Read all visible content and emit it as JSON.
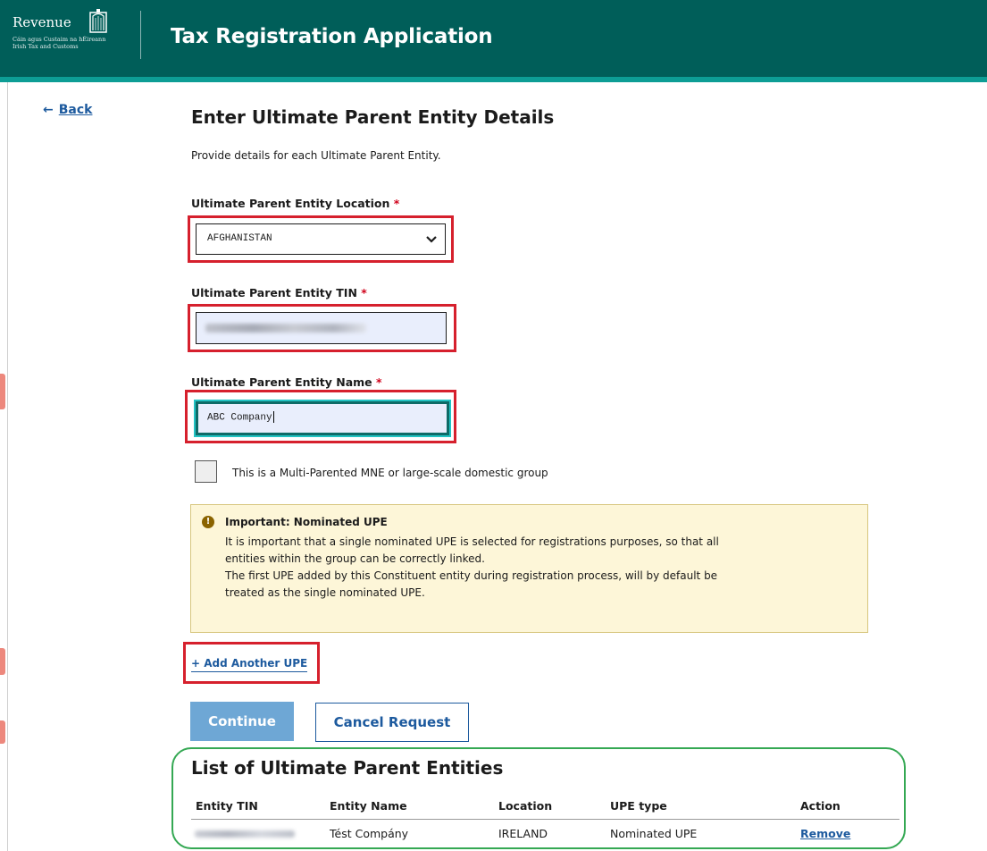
{
  "header": {
    "logo_word": "Revenue",
    "logo_sub_1": "Cáin agus Custaim na hÉireann",
    "logo_sub_2": "Irish Tax and Customs",
    "app_title": "Tax Registration Application"
  },
  "nav": {
    "back_arrow": "←",
    "back_label": "Back"
  },
  "page": {
    "title": "Enter Ultimate Parent Entity Details",
    "intro": "Provide details for each Ultimate Parent Entity."
  },
  "form": {
    "required_mark": "*",
    "location": {
      "label": "Ultimate Parent Entity Location",
      "value": "AFGHANISTAN"
    },
    "tin": {
      "label": "Ultimate Parent Entity TIN",
      "value": ""
    },
    "name": {
      "label": "Ultimate Parent Entity Name",
      "value": "ABC Company"
    },
    "multi_parent_checkbox": {
      "label": "This is a Multi-Parented MNE or large-scale domestic group",
      "checked": false
    }
  },
  "alert": {
    "icon": "!",
    "title": "Important: Nominated UPE",
    "line1": "It is important that a single nominated UPE is selected for registrations purposes, so that all",
    "line2": "entities within the group can be correctly linked.",
    "line3": "The first UPE added by this Constituent entity during registration process, will by default be",
    "line4": "treated as the single nominated UPE."
  },
  "actions": {
    "add_another": "+ Add Another UPE",
    "continue": "Continue",
    "cancel": "Cancel Request"
  },
  "list": {
    "title": "List of Ultimate Parent Entities",
    "columns": [
      "Entity TIN",
      "Entity Name",
      "Location",
      "UPE type",
      "Action"
    ],
    "rows": [
      {
        "tin": "",
        "name": "Tést Compány",
        "location": "IRELAND",
        "upe_type": "Nominated UPE",
        "action": "Remove"
      }
    ]
  },
  "colors": {
    "header_bg": "#005e59",
    "header_stripe": "#0d9d95",
    "link": "#1d5a9e",
    "annotation_red": "#d6202d",
    "annotation_green": "#34a853",
    "alert_bg": "#fdf6d8"
  }
}
